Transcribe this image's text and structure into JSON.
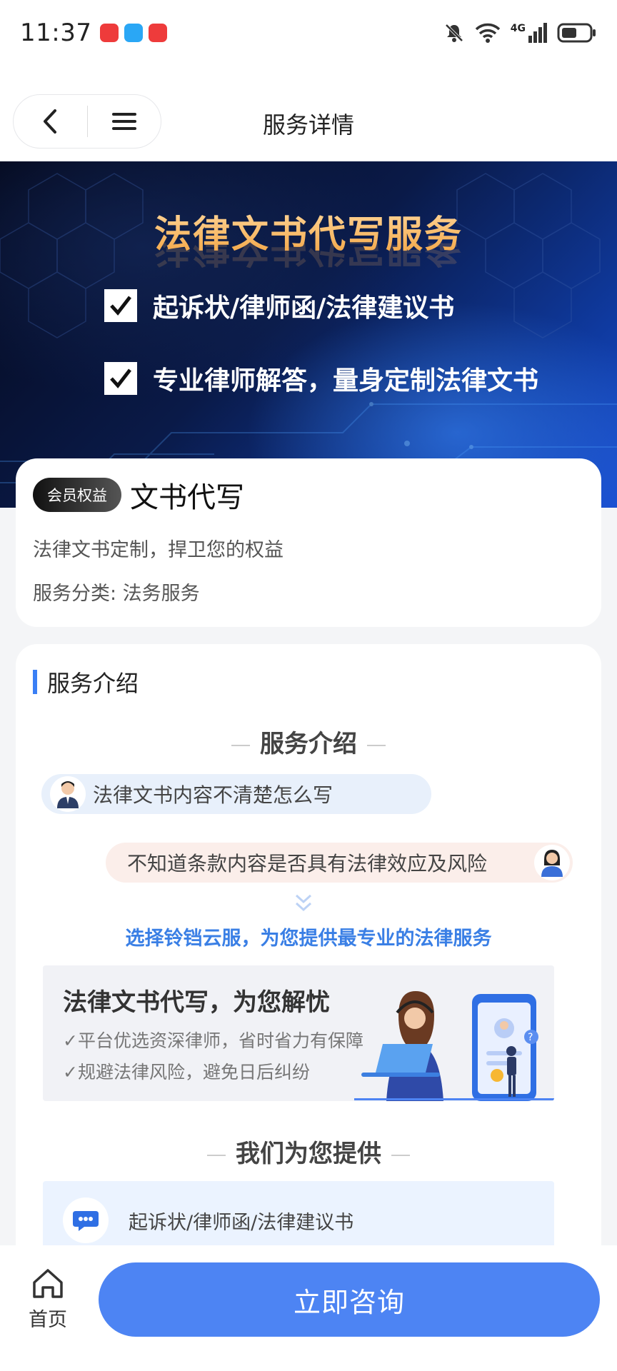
{
  "status_bar": {
    "time": "11:37",
    "network": "4G",
    "app_icons": [
      "huawei-app-icon",
      "message-app-icon",
      "huawei-app-icon"
    ],
    "colors": {
      "app_red": "#ee3b3b",
      "app_blue": "#2aa7f5"
    }
  },
  "nav": {
    "title": "服务详情",
    "back_icon": "chevron-left-icon",
    "menu_icon": "menu-icon"
  },
  "banner": {
    "headline": "法律文书代写服务",
    "points": [
      "起诉状/律师函/法律建议书",
      "专业律师解答，量身定制法律文书"
    ],
    "colors": {
      "headline": "#f3a542",
      "background": "#0a1a48"
    }
  },
  "service": {
    "badge": "会员权益",
    "title": "文书代写",
    "description": "法律文书定制，捍卫您的权益",
    "category": "服务分类:  法务服务"
  },
  "intro": {
    "section_label": "服务介绍",
    "heading": "服务介绍",
    "question_left": "法律文书内容不清楚怎么写",
    "question_right": "不知道条款内容是否具有法律效应及风险",
    "slogan": "选择铃铛云服，为您提供最专业的法律服务",
    "promo": {
      "title": "法律文书代写，为您解忧",
      "points": [
        "✓平台优选资深律师，省时省力有保障",
        "✓规避法律风险，避免日后纠纷"
      ]
    },
    "offer_heading": "我们为您提供",
    "offers": [
      "起诉状/律师函/法律建议书"
    ]
  },
  "bottom": {
    "home_label": "首页",
    "cta_label": "立即咨询",
    "colors": {
      "cta": "#4d84f3",
      "accent": "#3a7ff5"
    }
  }
}
